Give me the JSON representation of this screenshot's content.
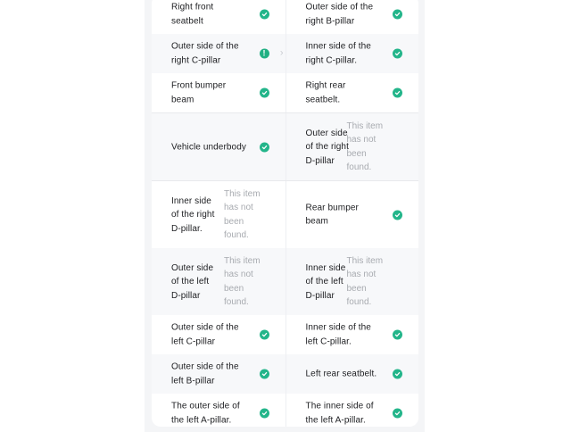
{
  "colors": {
    "success": "#23b58a",
    "muted_text": "#a8abb0",
    "alt_background": "#f7f8fa"
  },
  "rows": [
    {
      "left": {
        "label": "Right front\nseatbelt",
        "status": "ok",
        "icon": "check-circle-icon"
      },
      "right": {
        "label": "Outer side of the\nright B-pillar",
        "status": "ok",
        "icon": "check-circle-icon"
      }
    },
    {
      "left": {
        "label": "Outer side of the\nright C-pillar",
        "status": "warning",
        "icon": "exclamation-circle-icon"
      },
      "chevron": "›",
      "right": {
        "label": "Inner side of the\nright C-pillar.",
        "status": "ok",
        "icon": "check-circle-icon"
      }
    },
    {
      "left": {
        "label": "Front bumper\nbeam",
        "status": "ok",
        "icon": "check-circle-icon"
      },
      "right": {
        "label": "Right rear\nseatbelt.",
        "status": "ok",
        "icon": "check-circle-icon"
      }
    },
    {
      "left": {
        "label": "Vehicle underbody",
        "status": "ok",
        "icon": "check-circle-icon"
      },
      "right": {
        "label": "Outer side\nof the right\nD-pillar",
        "status": "missing",
        "note": "This item\nhas not\nbeen\nfound."
      }
    },
    {
      "left": {
        "label": "Inner side\nof the right\nD-pillar.",
        "status": "missing",
        "note": "This item\nhas not\nbeen\nfound."
      },
      "right": {
        "label": "Rear bumper\nbeam",
        "status": "ok",
        "icon": "check-circle-icon"
      }
    },
    {
      "left": {
        "label": "Outer side\nof the left\nD-pillar",
        "status": "missing",
        "note": "This item\nhas not\nbeen\nfound."
      },
      "right": {
        "label": "Inner side\nof the left\nD-pillar",
        "status": "missing",
        "note": "This item\nhas not\nbeen\nfound."
      }
    },
    {
      "left": {
        "label": "Outer side of the\nleft C-pillar",
        "status": "ok",
        "icon": "check-circle-icon"
      },
      "right": {
        "label": "Inner side of the\nleft C-pillar.",
        "status": "ok",
        "icon": "check-circle-icon"
      }
    },
    {
      "left": {
        "label": "Outer side of the\nleft B-pillar",
        "status": "ok",
        "icon": "check-circle-icon"
      },
      "right": {
        "label": "Left rear seatbelt.",
        "status": "ok",
        "icon": "check-circle-icon"
      }
    },
    {
      "left": {
        "label": "The outer side of\nthe left A-pillar.",
        "status": "ok",
        "icon": "check-circle-icon"
      },
      "right": {
        "label": "The inner side of\nthe left A-pillar.",
        "status": "ok",
        "icon": "check-circle-icon"
      }
    }
  ]
}
